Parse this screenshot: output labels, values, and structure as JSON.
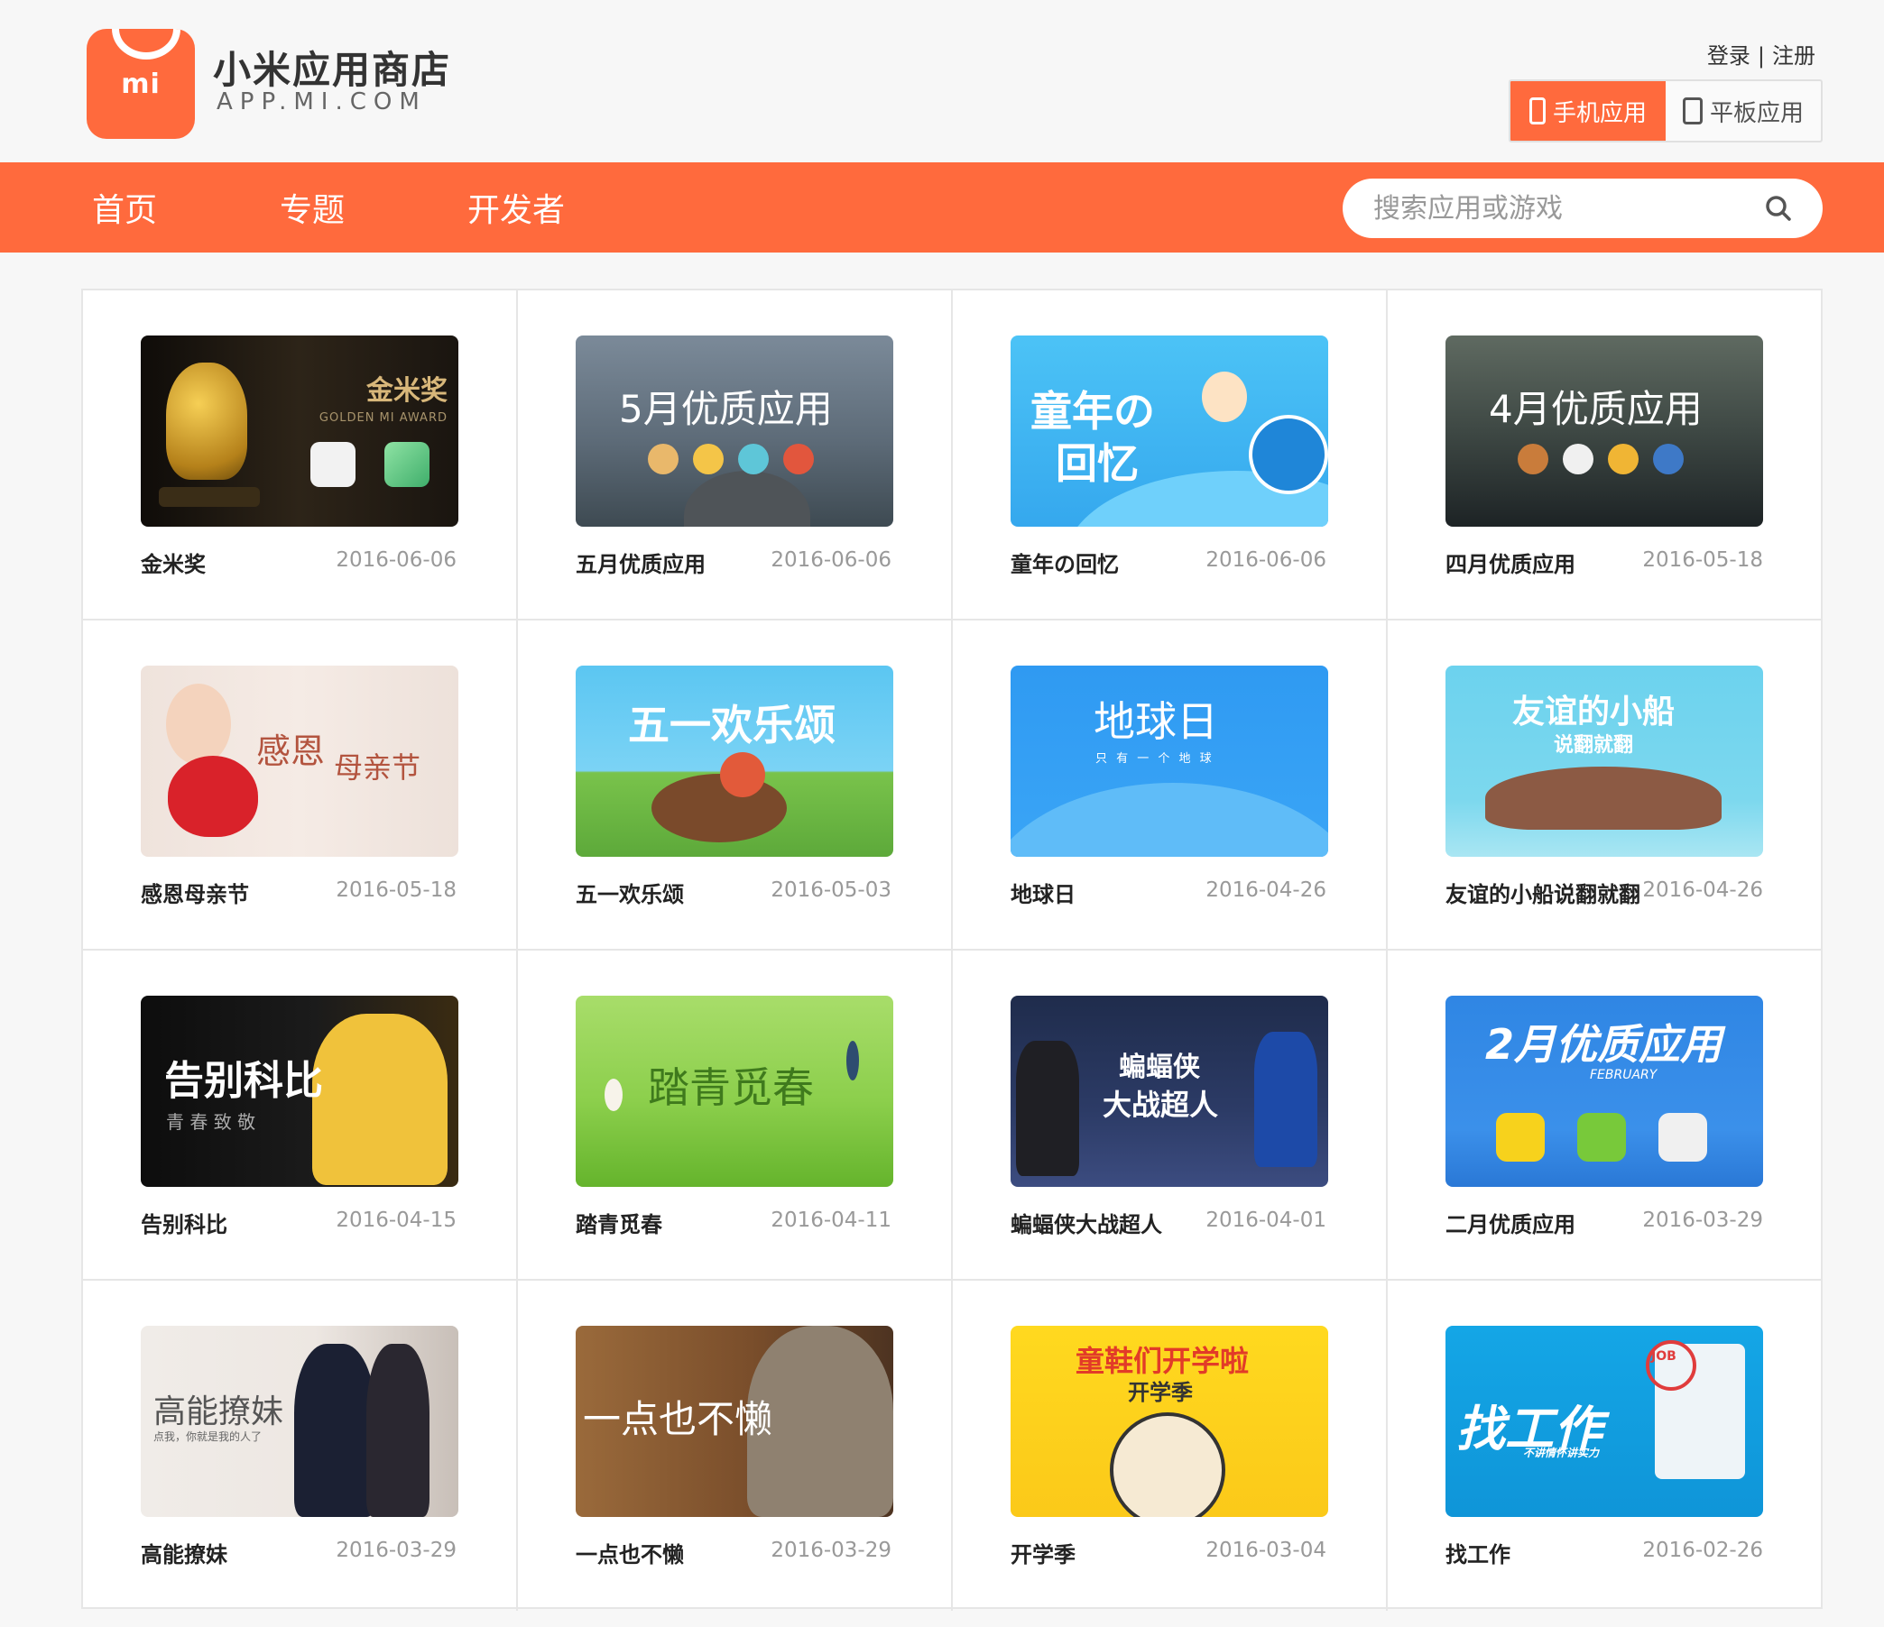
{
  "header": {
    "logo_mark": "mi",
    "brand_name": "小米应用商店",
    "brand_domain": "APP.MI.COM",
    "login_label": "登录",
    "separator": "|",
    "register_label": "注册",
    "device_tabs": [
      {
        "label": "手机应用",
        "active": true,
        "icon": "phone-icon"
      },
      {
        "label": "平板应用",
        "active": false,
        "icon": "tablet-icon"
      }
    ]
  },
  "nav": {
    "items": [
      {
        "label": "首页"
      },
      {
        "label": "专题"
      },
      {
        "label": "开发者"
      }
    ],
    "search_placeholder": "搜索应用或游戏",
    "search_value": ""
  },
  "colors": {
    "accent": "#ff6a3d",
    "background": "#f7f7f7"
  },
  "topics": [
    {
      "title": "金米奖",
      "date": "2016-06-06",
      "banner_text": "金米奖",
      "banner_sub": "GOLDEN MI AWARD"
    },
    {
      "title": "五月优质应用",
      "date": "2016-06-06",
      "banner_text": "5月优质应用"
    },
    {
      "title": "童年の回忆",
      "date": "2016-06-06",
      "banner_text": "童年の",
      "banner_sub": "回忆"
    },
    {
      "title": "四月优质应用",
      "date": "2016-05-18",
      "banner_text": "4月优质应用"
    },
    {
      "title": "感恩母亲节",
      "date": "2016-05-18",
      "banner_text": "感恩",
      "banner_sub": "母亲节"
    },
    {
      "title": "五一欢乐颂",
      "date": "2016-05-03",
      "banner_text": "五一欢乐颂"
    },
    {
      "title": "地球日",
      "date": "2016-04-26",
      "banner_text": "地球日",
      "banner_sub": "只 有 一 个 地 球"
    },
    {
      "title": "友谊的小船说翻就翻",
      "date": "2016-04-26",
      "banner_text": "友谊的小船",
      "banner_sub": "说翻就翻"
    },
    {
      "title": "告别科比",
      "date": "2016-04-15",
      "banner_text": "告别科比",
      "banner_sub": "青  春  致  敬"
    },
    {
      "title": "踏青觅春",
      "date": "2016-04-11",
      "banner_text": "踏青觅春"
    },
    {
      "title": "蝙蝠侠大战超人",
      "date": "2016-04-01",
      "banner_text": "蝙蝠侠",
      "banner_sub": "大战超人"
    },
    {
      "title": "二月优质应用",
      "date": "2016-03-29",
      "banner_text": "2月优质应用",
      "banner_sub": "FEBRUARY"
    },
    {
      "title": "高能撩妹",
      "date": "2016-03-29",
      "banner_text": "高能撩妹",
      "banner_sub": "点我，你就是我的人了"
    },
    {
      "title": "一点也不懒",
      "date": "2016-03-29",
      "banner_text": "一点也不懒"
    },
    {
      "title": "开学季",
      "date": "2016-03-04",
      "banner_text": "童鞋们开学啦",
      "banner_sub": "开学季"
    },
    {
      "title": "找工作",
      "date": "2016-02-26",
      "banner_text": "找工作",
      "banner_sub": "不讲情怀讲实力",
      "banner_badge": "JOB"
    }
  ]
}
